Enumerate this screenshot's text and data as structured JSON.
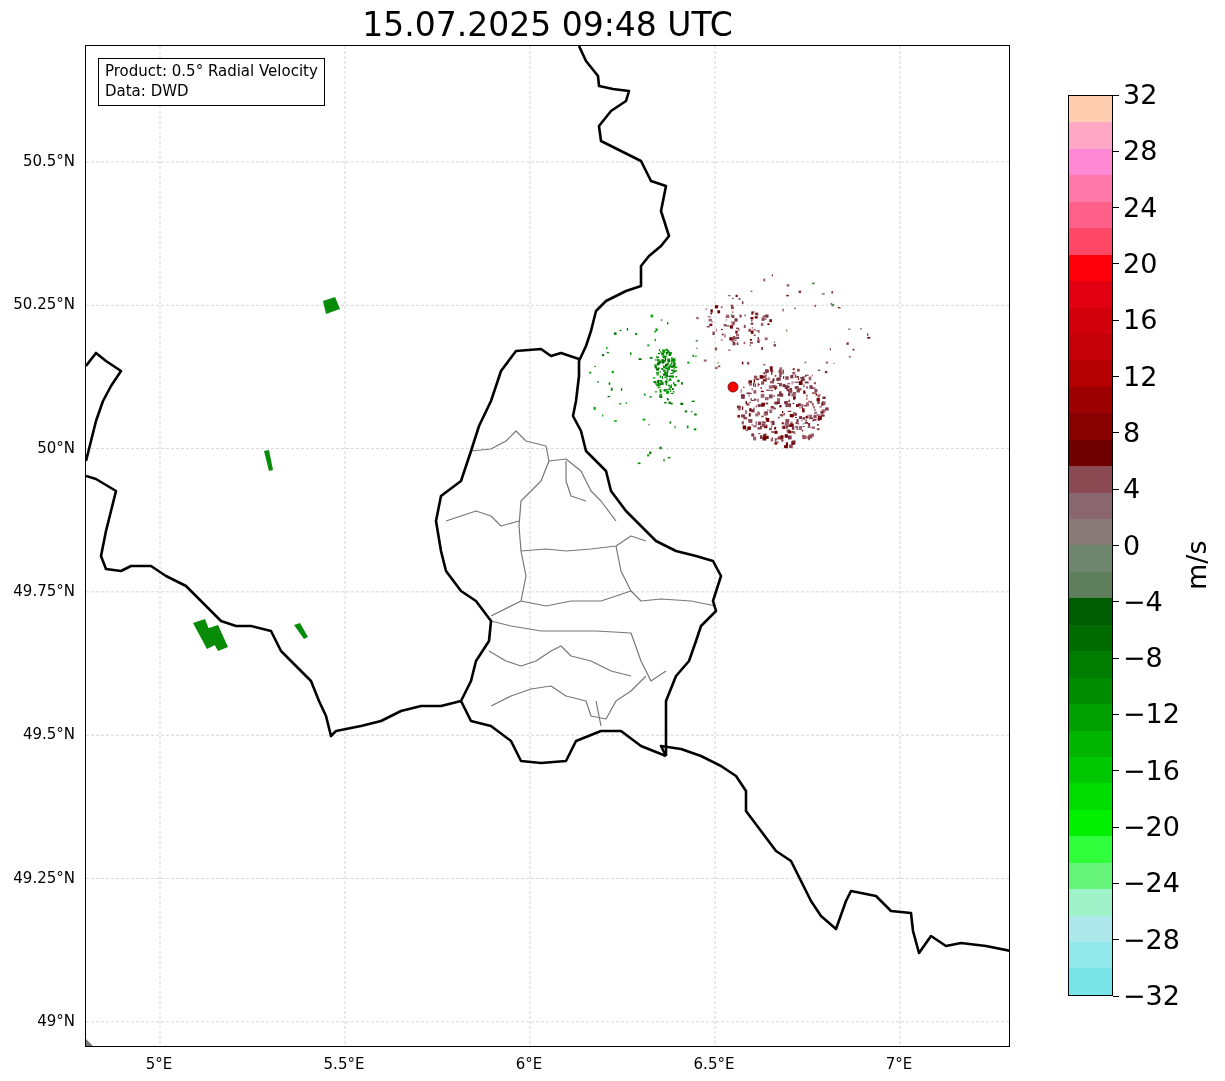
{
  "title": "15.07.2025 09:48 UTC",
  "info_box": {
    "lines": [
      "Product: 0.5° Radial Velocity",
      "Data: DWD"
    ]
  },
  "y_axis": {
    "ticks": [
      "50.5°N",
      "50.25°N",
      "50°N",
      "49.75°N",
      "49.5°N",
      "49.25°N",
      "49°N"
    ]
  },
  "x_axis": {
    "ticks": [
      "5°E",
      "5.5°E",
      "6°E",
      "6.5°E",
      "7°E"
    ]
  },
  "colorbar": {
    "label": "m/s",
    "ticks": [
      "32",
      "28",
      "24",
      "20",
      "16",
      "12",
      "8",
      "4",
      "0",
      "−4",
      "−8",
      "−12",
      "−16",
      "−20",
      "−24",
      "−28",
      "−32"
    ],
    "bands": [
      {
        "color": "#ffcdb0"
      },
      {
        "color": "#ffa8c6"
      },
      {
        "color": "#ff88d4"
      },
      {
        "color": "#ff78a8"
      },
      {
        "color": "#ff5f88"
      },
      {
        "color": "#ff4866"
      },
      {
        "color": "#ff000a"
      },
      {
        "color": "#e00010"
      },
      {
        "color": "#d2000a"
      },
      {
        "color": "#c40008"
      },
      {
        "color": "#b40000"
      },
      {
        "color": "#9c0000"
      },
      {
        "color": "#880000"
      },
      {
        "color": "#700000"
      },
      {
        "color": "#8a4a52"
      },
      {
        "color": "#8a6670"
      },
      {
        "color": "#8a7a78"
      },
      {
        "color": "#6e866e"
      },
      {
        "color": "#5e7e5c"
      },
      {
        "color": "#005c00"
      },
      {
        "color": "#006c00"
      },
      {
        "color": "#007c00"
      },
      {
        "color": "#008c00"
      },
      {
        "color": "#00a000"
      },
      {
        "color": "#00b400"
      },
      {
        "color": "#00c800"
      },
      {
        "color": "#00dc00"
      },
      {
        "color": "#00f000"
      },
      {
        "color": "#30ff3c"
      },
      {
        "color": "#66f57a"
      },
      {
        "color": "#a0f2c8"
      },
      {
        "color": "#ace8ec"
      },
      {
        "color": "#90e8ea"
      },
      {
        "color": "#78e4e8"
      }
    ]
  }
}
